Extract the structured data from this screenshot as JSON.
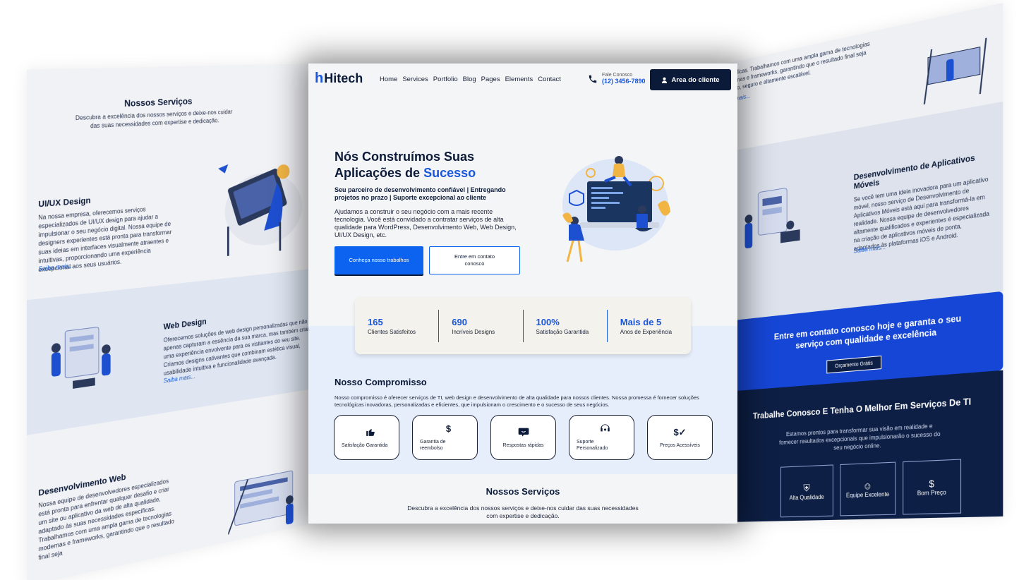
{
  "left": {
    "services_title": "Nossos Serviços",
    "services_sub": "Descubra a excelência dos nossos serviços e deixe-nos cuidar das suas necessidades com expertise e dedicação.",
    "uiux_title": "UI/UX Design",
    "uiux_text": "Na nossa empresa, oferecemos serviços especializados de UI/UX design para ajudar a impulsionar o seu negócio digital. Nossa equipe de designers experientes está pronta para transformar suas ideias em interfaces visualmente atraentes e intuitivas, proporcionando uma experiência excepcional aos seus usuários.",
    "uiux_link": "Saiba mais...",
    "web_title": "Web Design",
    "web_text": "Oferecemos soluções de web design personalizadas que não apenas capturam a essência da sua marca, mas também criam uma experiência envolvente para os visitantes do seu site. Criamos designs cativantes que combinam estética visual, usabilidade intuitiva e funcionalidade avançada.",
    "web_link": "Saiba mais...",
    "dev_title": "Desenvolvimento Web",
    "dev_text": "Nossa equipe de desenvolvedores especializados está pronta para enfrentar qualquer desafio e criar um site ou aplicativo da web de alta qualidade, adaptado às suas necessidades específicas. Trabalhamos com uma ampla gama de tecnologias modernas e frameworks, garantindo que o resultado final seja"
  },
  "right": {
    "top_text": "íficas. Trabalhamos com uma ampla gama de tecnologias rnas e frameworks, garantindo que o resultado final seja to, seguro e altamente escalável.",
    "top_link": "mais...",
    "mobile_title": "Desenvolvimento de Aplicativos Móveis",
    "mobile_text": "Se você tem uma ideia inovadora para um aplicativo móvel, nosso serviço de Desenvolvimento de Aplicativos Móveis está aqui para transformá-la em realidade. Nossa equipe de desenvolvedores altamente qualificados e experientes é especializada na criação de aplicativos móveis de ponta, adaptados às plataformas iOS e Android.",
    "mobile_link": "Saiba mais...",
    "cta_text": "Entre em contato conosco hoje e garanta o seu serviço com qualidade e excelência",
    "cta_button": "Orçamento Grátis",
    "work_title": "Trabalhe Conosco E Tenha O Melhor Em Serviços De TI",
    "work_text": "Estamos prontos para transformar sua visão em realidade e fornecer resultados excepcionais que impulsionarão o sucesso do seu negócio online.",
    "feature_cards": [
      "Alta Qualidade",
      "Equipe Excelente",
      "Bom Preço"
    ]
  },
  "nav": {
    "logo_mark": "h",
    "logo_text": "Hitech",
    "items": [
      "Home",
      "Services",
      "Portfolio",
      "Blog",
      "Pages",
      "Elements",
      "Contact"
    ],
    "contact_label": "Fale Conosco",
    "contact_phone": "(12) 3456-7890",
    "client_button": "Area do cliente"
  },
  "hero": {
    "title_line1": "Nós Construímos Suas",
    "title_line2_prefix": "Aplicações de ",
    "title_accent": "Sucesso",
    "subtitle": "Seu parceiro de desenvolvimento confiável | Entregando projetos no prazo | Suporte excepcional ao cliente",
    "description": "Ajudamos a construir o seu negócio com a mais recente tecnologia. Você está convidado a contratar serviços de alta qualidade para WordPress, Desenvolvimento Web, Web Design, UI/UX Design, etc.",
    "primary_button": "Conheça nosso trabalhos",
    "secondary_button": "Entre em contato conosco"
  },
  "stats": [
    {
      "value": "165",
      "label": "Clientes Satisfeitos"
    },
    {
      "value": "690",
      "label": "Incríveis Designs"
    },
    {
      "value": "100%",
      "label": "Satisfação Garantida"
    },
    {
      "value": "Mais de 5",
      "label": "Anos de Experiência"
    }
  ],
  "commitment": {
    "title": "Nosso Compromisso",
    "text": "Nosso compromisso é oferecer serviços de TI, web design e desenvolvimento de alta qualidade para nossos clientes. Nossa promessa é fornecer soluções tecnológicas inovadoras, personalizadas e eficientes, que impulsionam o crescimento e o sucesso de seus negócios.",
    "cards": [
      {
        "icon": "thumbs-up-icon",
        "label": "Satisfação Garantida"
      },
      {
        "icon": "dollar-icon",
        "label": "Garantia de reembolso"
      },
      {
        "icon": "chat-icon",
        "label": "Respostas rápidas"
      },
      {
        "icon": "support-icon",
        "label": "Suporte Personalizado"
      },
      {
        "icon": "price-icon",
        "label": "Preços Acessíveis"
      }
    ]
  },
  "services": {
    "title": "Nossos Serviços",
    "text": "Descubra a excelência dos nossos serviços e deixe-nos cuidar das suas necessidades com expertise e dedicação."
  },
  "colors": {
    "accent": "#1a56db",
    "dark": "#0b1a38",
    "primary_button": "#0c63f0",
    "cta_blue": "#1646d6",
    "navy": "#0d1f45"
  }
}
